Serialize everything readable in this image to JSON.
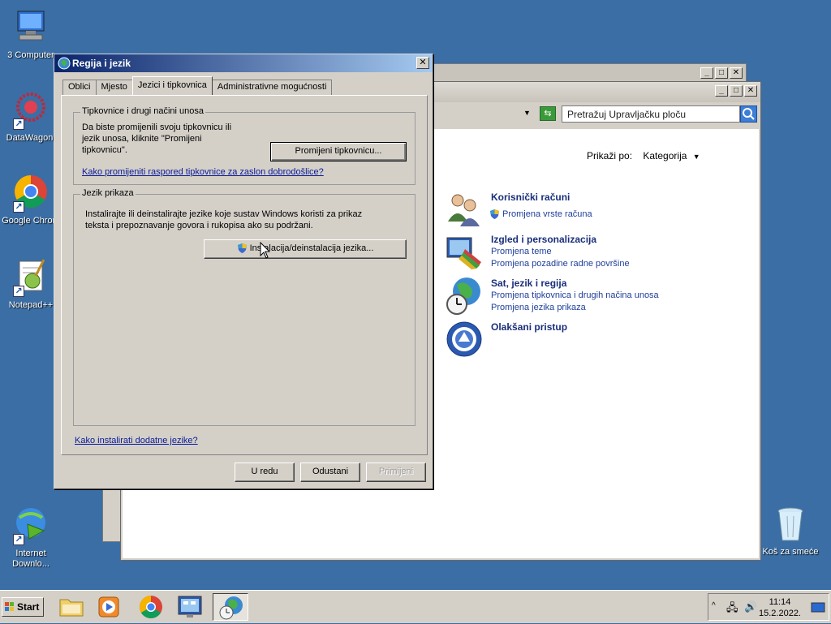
{
  "desktop": {
    "icons": [
      {
        "label": "3 Computer"
      },
      {
        "label": "DataWagon."
      },
      {
        "label": "Google Chrom"
      },
      {
        "label": "Notepad++"
      },
      {
        "label": "Internet Downlo..."
      },
      {
        "label": "Koš za smeće"
      }
    ]
  },
  "control_panel": {
    "search_placeholder": "Pretražuj Upravljačku ploču",
    "view_by_label": "Prikaži po:",
    "view_by_value": "Kategorija",
    "categories": [
      {
        "title": "Korisnički računi",
        "links": [
          "Promjena vrste računa"
        ]
      },
      {
        "title": "Izgled i personalizacija",
        "links": [
          "Promjena teme",
          "Promjena pozadine radne površine"
        ]
      },
      {
        "title": "Sat, jezik i regija",
        "links": [
          "Promjena tipkovnica i drugih načina unosa",
          "Promjena jezika prikaza"
        ]
      },
      {
        "title": "Olakšani pristup",
        "links": []
      }
    ]
  },
  "dialog": {
    "title": "Regija i jezik",
    "tabs": [
      "Oblici",
      "Mjesto",
      "Jezici i tipkovnica",
      "Administrativne mogućnosti"
    ],
    "active_tab": "Jezici i tipkovnica",
    "keyboards_group": {
      "legend": "Tipkovnice i drugi načini unosa",
      "text_lines": [
        "Da biste promijenili svoju tipkovnicu ili",
        "jezik unosa, kliknite \"Promijeni",
        "tipkovnicu\"."
      ],
      "button": "Promijeni tipkovnicu...",
      "link": "Kako promijeniti raspored tipkovnice za zaslon dobrodošlice?"
    },
    "display_language_group": {
      "legend": "Jezik prikaza",
      "text_lines": [
        "Instalirajte ili deinstalirajte jezike koje sustav Windows koristi za prikaz",
        "teksta i prepoznavanje govora i rukopisa ako su podržani."
      ],
      "button": "Instalacija/deinstalacija jezika..."
    },
    "bottom_link": "Kako instalirati dodatne jezike?",
    "buttons": {
      "ok": "U redu",
      "cancel": "Odustani",
      "apply": "Primijeni"
    }
  },
  "taskbar": {
    "start_label": "Start",
    "clock_time": "11:14",
    "clock_date": "15.2.2022."
  }
}
